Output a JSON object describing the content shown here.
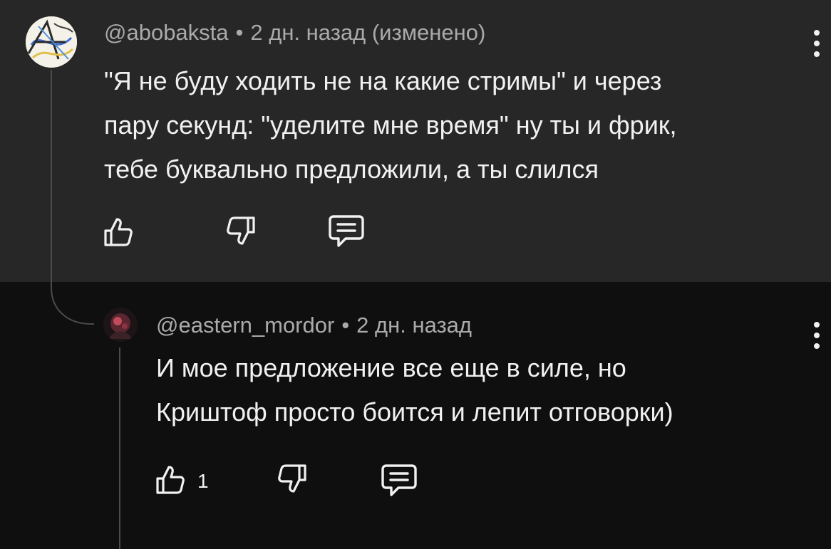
{
  "colors": {
    "parent_background": "#272727",
    "reply_background": "#0f0f0f",
    "text_primary": "#f1f1f1",
    "text_secondary": "#aaaaaa",
    "thread_line": "#4b4b4b"
  },
  "comments": [
    {
      "author": "@abobaksta",
      "separator": "•",
      "time": "2 дн. назад (изменено)",
      "text_lines": [
        "\"Я не буду ходить не на какие стримы\" и через",
        "пару секунд: \"уделите мне время\" ну ты и фрик,",
        "тебе буквально предложили, а ты слился"
      ],
      "like_count": "",
      "icons": {
        "avatar": "avatar-image",
        "like": "thumbs-up-icon",
        "dislike": "thumbs-down-icon",
        "reply": "reply-comment-icon",
        "menu": "more-vertical-icon"
      }
    },
    {
      "author": "@eastern_mordor",
      "separator": "•",
      "time": "2 дн. назад",
      "text_lines": [
        "И мое предложение все еще в силе, но",
        "Криштоф просто боится и лепит отговорки)"
      ],
      "like_count": "1",
      "icons": {
        "avatar": "avatar-image",
        "like": "thumbs-up-icon",
        "dislike": "thumbs-down-icon",
        "reply": "reply-comment-icon",
        "menu": "more-vertical-icon"
      }
    }
  ]
}
